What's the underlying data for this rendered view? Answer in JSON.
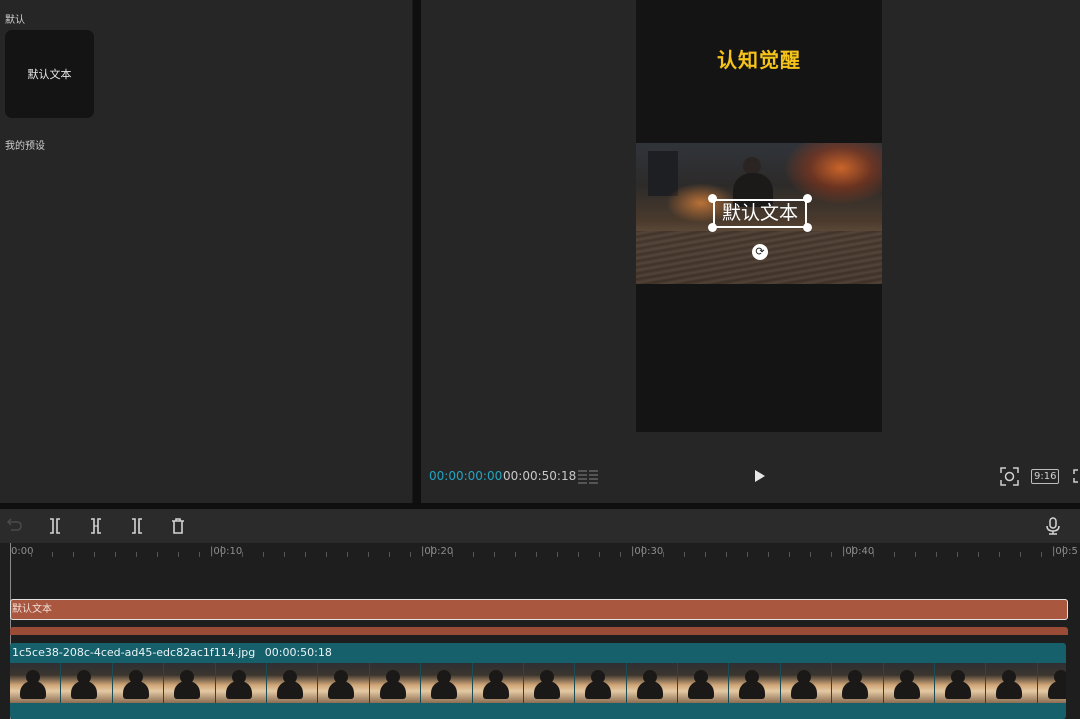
{
  "left_panel": {
    "section_default": "默认",
    "preset_card_label": "默认文本",
    "section_my_presets": "我的预设"
  },
  "preview": {
    "title": "认知觉醒",
    "title_color": "#f5c31a",
    "overlay_text": "默认文本",
    "current_time": "00:00:00:00",
    "total_time": "00:00:50:18",
    "aspect_ratio": "9:16",
    "accent_color": "#21a6c1"
  },
  "toolbar": {
    "icons": [
      "undo-icon",
      "split-icon",
      "trim-left-icon",
      "trim-right-icon",
      "delete-icon",
      "microphone-icon"
    ]
  },
  "timeline": {
    "ruler_labels": [
      "0:00",
      "|00:10",
      "|00:20",
      "|00:30",
      "|00:40",
      "|00:5"
    ],
    "text_clip_label": "默认文本",
    "text_clip_color": "#a9573f",
    "video_clip_name": "1c5ce38-208c-4ced-ad45-edc82ac1f114.jpg",
    "video_clip_duration": "00:00:50:18",
    "video_clip_color": "#16606b"
  }
}
